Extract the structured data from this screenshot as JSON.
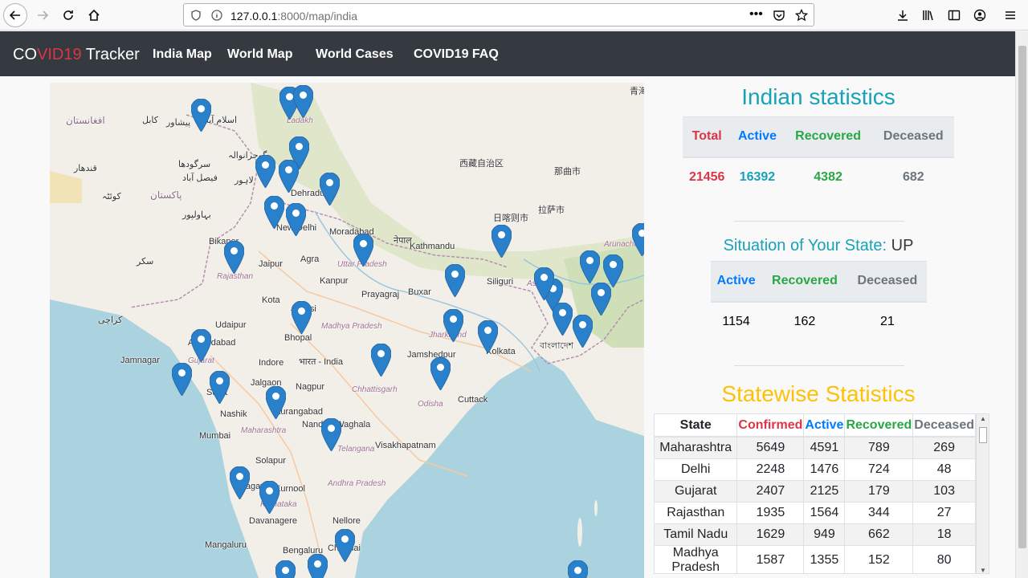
{
  "browser": {
    "url_host": "127.0.0.1",
    "url_rest": ":8000/map/india"
  },
  "navbar": {
    "brand_part1": "CO",
    "brand_part2": "VID19",
    "brand_part3": " Tracker",
    "links": [
      "India Map",
      "World Map",
      "World Cases",
      "COVID19 FAQ"
    ]
  },
  "map": {
    "places": [
      {
        "name": "افغانستان"
      },
      {
        "name": "کابل"
      },
      {
        "name": "پیشاور"
      },
      {
        "name": "اسلام آباد"
      },
      {
        "name": "Ladakh"
      },
      {
        "name": "گوجرانوالہ"
      },
      {
        "name": "سرگودھا"
      },
      {
        "name": "قندھار"
      },
      {
        "name": "فیصل آباد"
      },
      {
        "name": "لاہور"
      },
      {
        "name": "کوئٹہ"
      },
      {
        "name": "پاکستان"
      },
      {
        "name": "بہاولپور"
      },
      {
        "name": "Dehradun"
      },
      {
        "name": "New Delhi"
      },
      {
        "name": "Moradabad"
      },
      {
        "name": "Bikaner"
      },
      {
        "name": "سکر"
      },
      {
        "name": "Jaipur"
      },
      {
        "name": "Agra"
      },
      {
        "name": "Rajasthan"
      },
      {
        "name": "Kanpur"
      },
      {
        "name": "Uttar Pradesh"
      },
      {
        "name": "नेपाल"
      },
      {
        "name": "Kathmandu"
      },
      {
        "name": "Kota"
      },
      {
        "name": "Jhansi"
      },
      {
        "name": "Prayagraj"
      },
      {
        "name": "Buxar"
      },
      {
        "name": "کراچی"
      },
      {
        "name": "Udaipur"
      },
      {
        "name": "Madhya Pradesh"
      },
      {
        "name": "Ahmedabad"
      },
      {
        "name": "Bhopal"
      },
      {
        "name": "Jamnagar"
      },
      {
        "name": "Gujarat"
      },
      {
        "name": "Indore"
      },
      {
        "name": "भारत - India"
      },
      {
        "name": "Jharkhand"
      },
      {
        "name": "Jamshedpur"
      },
      {
        "name": "Kolkata"
      },
      {
        "name": "Surat"
      },
      {
        "name": "Jalgaon"
      },
      {
        "name": "Nagpur"
      },
      {
        "name": "Chhattisgarh"
      },
      {
        "name": "Odisha"
      },
      {
        "name": "Cuttack"
      },
      {
        "name": "Nashik"
      },
      {
        "name": "Aurangabad"
      },
      {
        "name": "Mumbai"
      },
      {
        "name": "Maharashtra"
      },
      {
        "name": "Nanded-Waghala"
      },
      {
        "name": "Telangana"
      },
      {
        "name": "Visakhapatnam"
      },
      {
        "name": "Solapur"
      },
      {
        "name": "Belagavi"
      },
      {
        "name": "Kurnool"
      },
      {
        "name": "Karnataka"
      },
      {
        "name": "Andhra Pradesh"
      },
      {
        "name": "Davanagere"
      },
      {
        "name": "Nellore"
      },
      {
        "name": "Mangaluru"
      },
      {
        "name": "Bengaluru"
      },
      {
        "name": "Chennai"
      },
      {
        "name": "西藏自治区"
      },
      {
        "name": "那曲市"
      },
      {
        "name": "日喀则市"
      },
      {
        "name": "拉萨市"
      },
      {
        "name": "Siliguri"
      },
      {
        "name": "Assam"
      },
      {
        "name": "বাংলাদেশ"
      },
      {
        "name": "Arunachal Pradesh"
      },
      {
        "name": "青海"
      }
    ],
    "markers": 38
  },
  "indian_stats": {
    "heading": "Indian statistics",
    "headers": [
      "Total",
      "Active",
      "Recovered",
      "Deceased"
    ],
    "values": [
      "21456",
      "16392",
      "4382",
      "682"
    ]
  },
  "state_stats": {
    "heading": "Situation of Your State: ",
    "state_code": "UP",
    "headers": [
      "Active",
      "Recovered",
      "Deceased"
    ],
    "values": [
      "1154",
      "162",
      "21"
    ]
  },
  "statewise": {
    "heading": "Statewise Statistics",
    "headers": [
      "State",
      "Confirmed",
      "Active",
      "Recovered",
      "Deceased"
    ],
    "rows": [
      [
        "Maharashtra",
        "5649",
        "4591",
        "789",
        "269"
      ],
      [
        "Delhi",
        "2248",
        "1476",
        "724",
        "48"
      ],
      [
        "Gujarat",
        "2407",
        "2125",
        "179",
        "103"
      ],
      [
        "Rajasthan",
        "1935",
        "1564",
        "344",
        "27"
      ],
      [
        "Tamil Nadu",
        "1629",
        "949",
        "662",
        "18"
      ],
      [
        "Madhya Pradesh",
        "1587",
        "1355",
        "152",
        "80"
      ]
    ]
  },
  "colors": {
    "navbar_bg": "#343a40",
    "teal": "#17a2b8",
    "red": "#dc3545",
    "blue": "#007bff",
    "green": "#28a745",
    "gray": "#6c757d",
    "yellow": "#ffc107",
    "marker": "#2a81cb"
  }
}
